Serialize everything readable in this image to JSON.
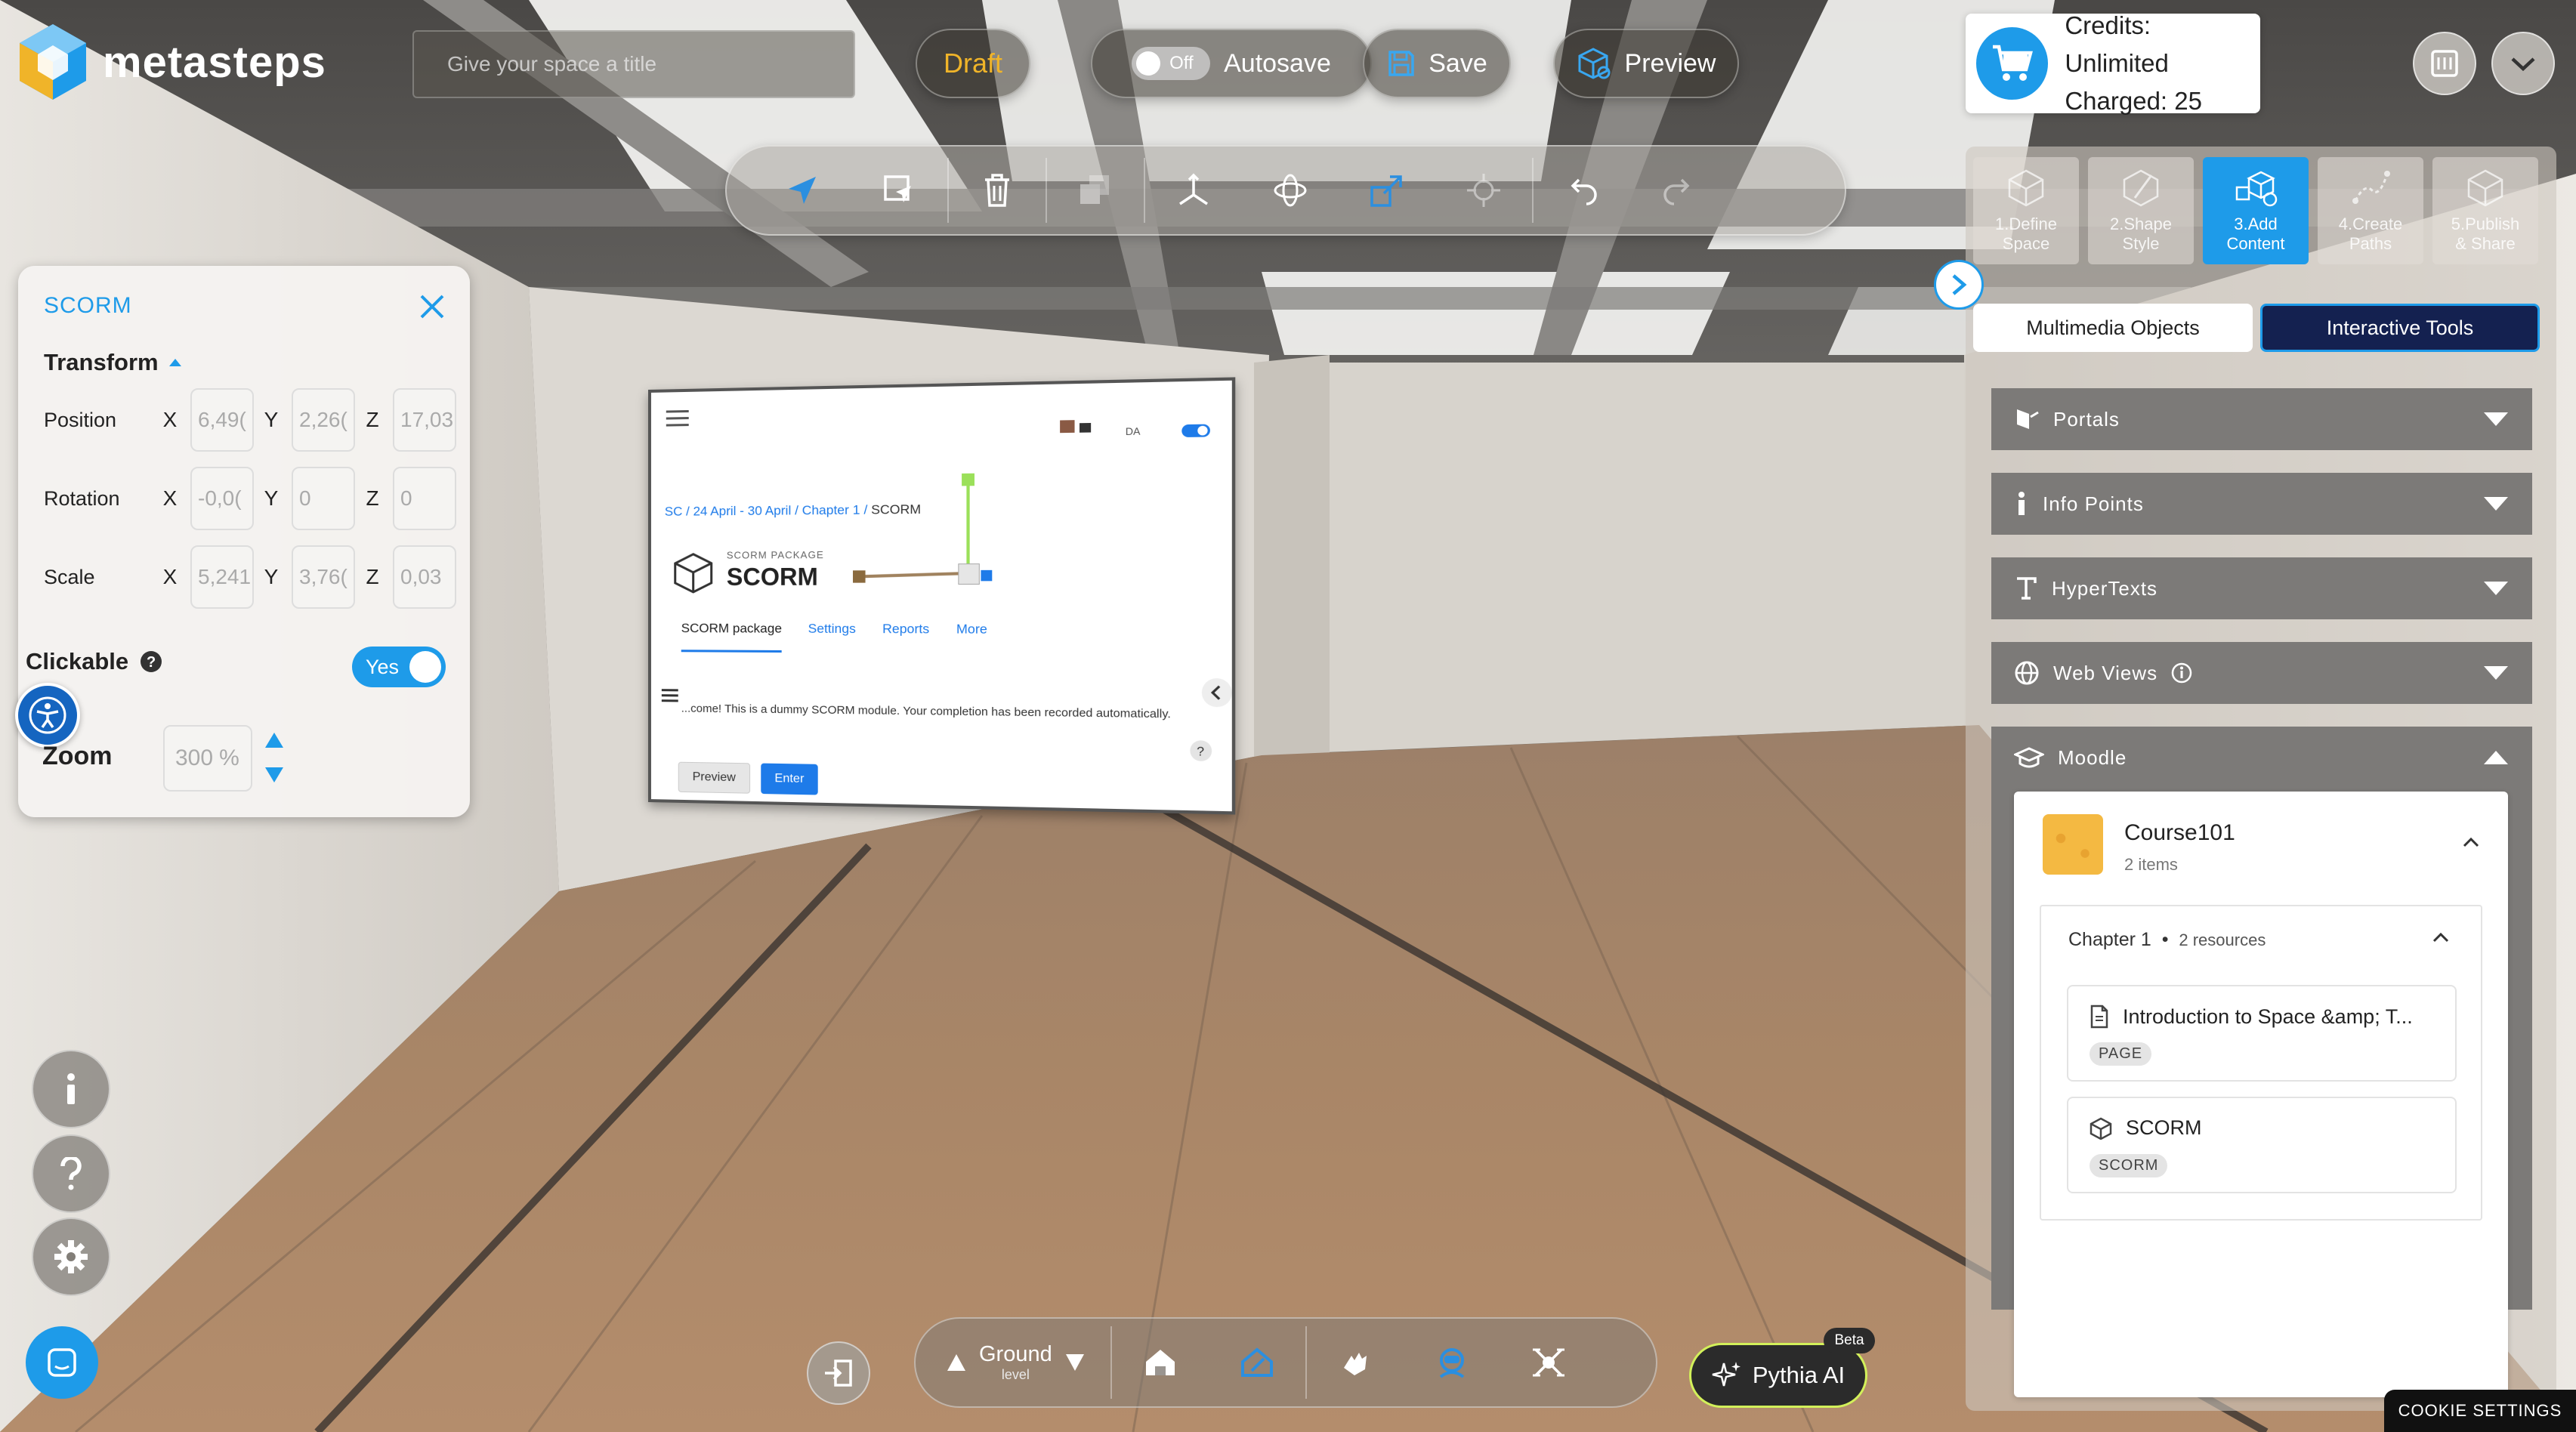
{
  "app": {
    "logo_text": "metasteps",
    "title_placeholder": "Give your space a title",
    "draft_label": "Draft",
    "autosave_label": "Autosave",
    "autosave_state": "Off",
    "save_label": "Save",
    "preview_label": "Preview",
    "credits_line1": "Credits: Unlimited",
    "credits_line2": "Charged: 25"
  },
  "toolbar": {
    "tools": [
      "select-icon",
      "move-pointer-icon",
      "trash-icon",
      "duplicate-icon",
      "translate-axes-icon",
      "rotate-icon",
      "scale-icon",
      "crosshair-icon",
      "undo-icon",
      "redo-icon"
    ]
  },
  "left_panel": {
    "title": "SCORM",
    "section": "Transform",
    "position_label": "Position",
    "rotation_label": "Rotation",
    "scale_label": "Scale",
    "position": {
      "x": "6,49(",
      "y": "2,26(",
      "z": "17,03"
    },
    "rotation": {
      "x": "-0,0(",
      "y": "0",
      "z": "0"
    },
    "scale": {
      "x": "5,241",
      "y": "3,76(",
      "z": "0,03"
    },
    "axis_x": "X",
    "axis_y": "Y",
    "axis_z": "Z",
    "clickable_label": "Clickable",
    "clickable_value": "Yes",
    "zoom_label": "Zoom",
    "zoom_value": "300",
    "zoom_unit": "%"
  },
  "bottom_bar": {
    "level_name": "Ground",
    "level_sub": "level",
    "pythia_label": "Pythia AI",
    "beta_label": "Beta"
  },
  "right_panel": {
    "steps": [
      {
        "line1": "1.Define",
        "line2": "Space",
        "active": false
      },
      {
        "line1": "2.Shape",
        "line2": "Style",
        "active": false
      },
      {
        "line1": "3.Add",
        "line2": "Content",
        "active": true
      },
      {
        "line1": "4.Create",
        "line2": "Paths",
        "active": false
      },
      {
        "line1": "5.Publish",
        "line2": "& Share",
        "active": false
      }
    ],
    "tab_multimedia": "Multimedia Objects",
    "tab_interactive": "Interactive Tools",
    "sections": [
      "Portals",
      "Info Points",
      "HyperTexts",
      "Web Views",
      "Moodle"
    ],
    "course": {
      "name": "Course101",
      "items": "2 items",
      "chapter": "Chapter 1",
      "chapter_sep": "•",
      "chapter_resources": "2 resources",
      "resources": [
        {
          "title": "Introduction to Space &amp; T...",
          "badge": "PAGE"
        },
        {
          "title": "SCORM",
          "badge": "SCORM"
        }
      ]
    }
  },
  "scorm_screen": {
    "crumb_1": "SC",
    "crumb_2": "24 April - 30 April",
    "crumb_3": "Chapter 1",
    "crumb_4": "SCORM",
    "crumb_sep": "/",
    "package_label": "SCORM PACKAGE",
    "title": "SCORM",
    "lang": "DA",
    "tabs": [
      "SCORM package",
      "Settings",
      "Reports",
      "More"
    ],
    "message": "...come! This is a dummy SCORM module. Your completion has been recorded automatically.",
    "btn_preview": "Preview",
    "btn_enter": "Enter"
  },
  "cookie_label": "COOKIE SETTINGS",
  "colors": {
    "accent": "#1e9be9",
    "draft": "#f0b429",
    "dark_tab": "#142150",
    "pythia_border": "#d2f05a"
  }
}
